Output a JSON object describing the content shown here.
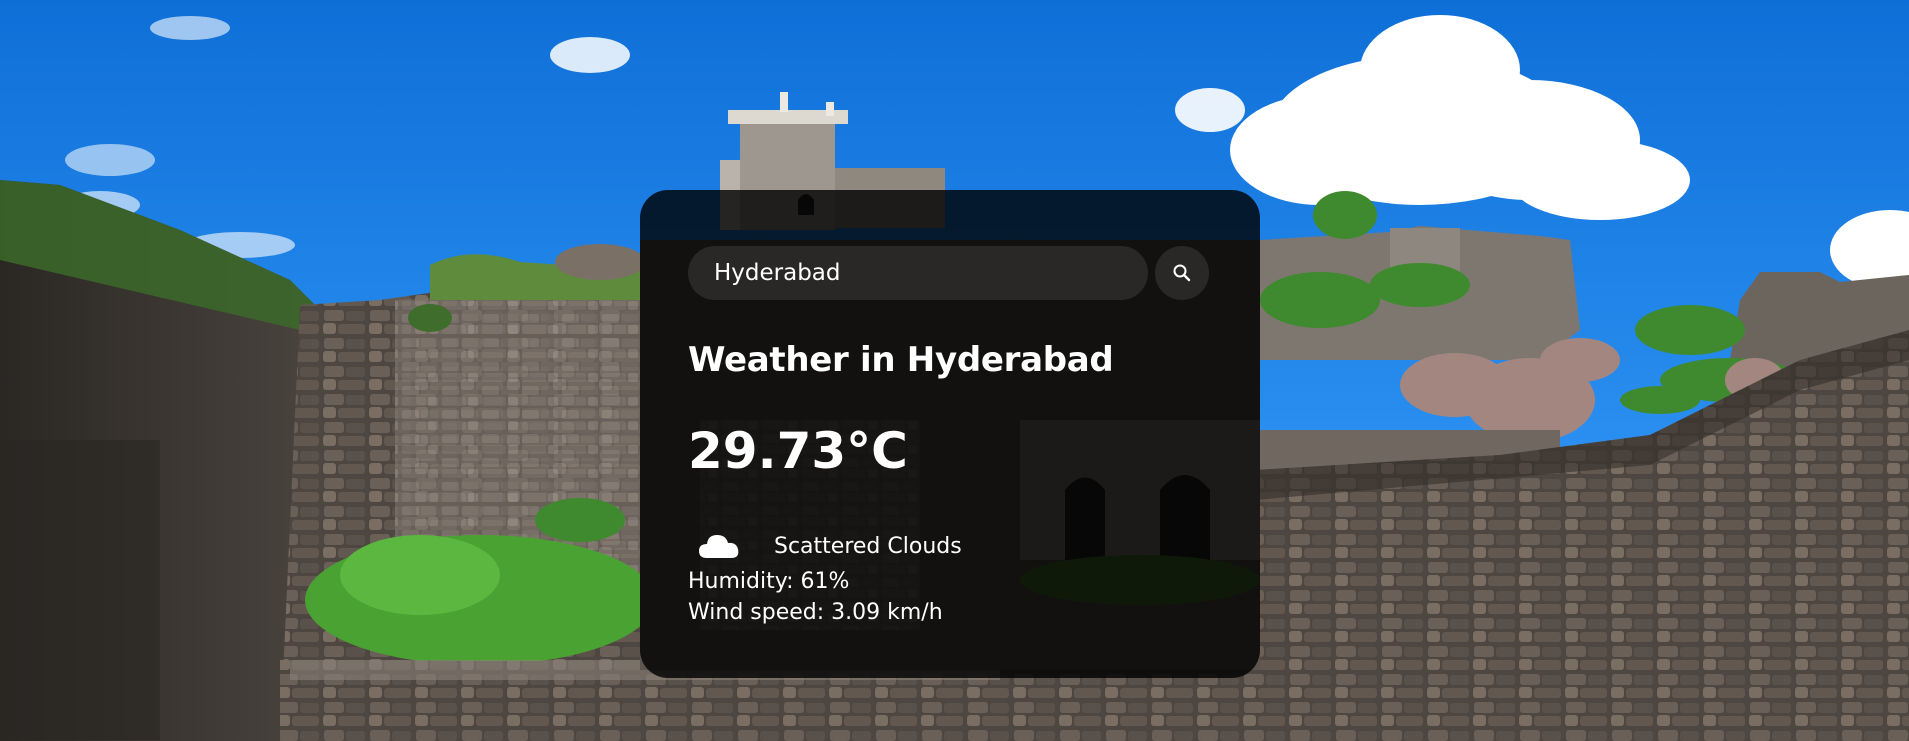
{
  "search": {
    "value": "Hyderabad",
    "icon": "search-icon"
  },
  "weather": {
    "title": "Weather in Hyderabad",
    "temperature": "29.73°C",
    "icon": "cloud-icon",
    "description": "Scattered Clouds",
    "humidity": "Humidity: 61%",
    "wind": "Wind speed: 3.09 km/h"
  },
  "background": {
    "icon": "fort-landscape-photo"
  },
  "colors": {
    "sky": "#1d7fe0",
    "card": "#000000",
    "text": "#ffffff"
  }
}
